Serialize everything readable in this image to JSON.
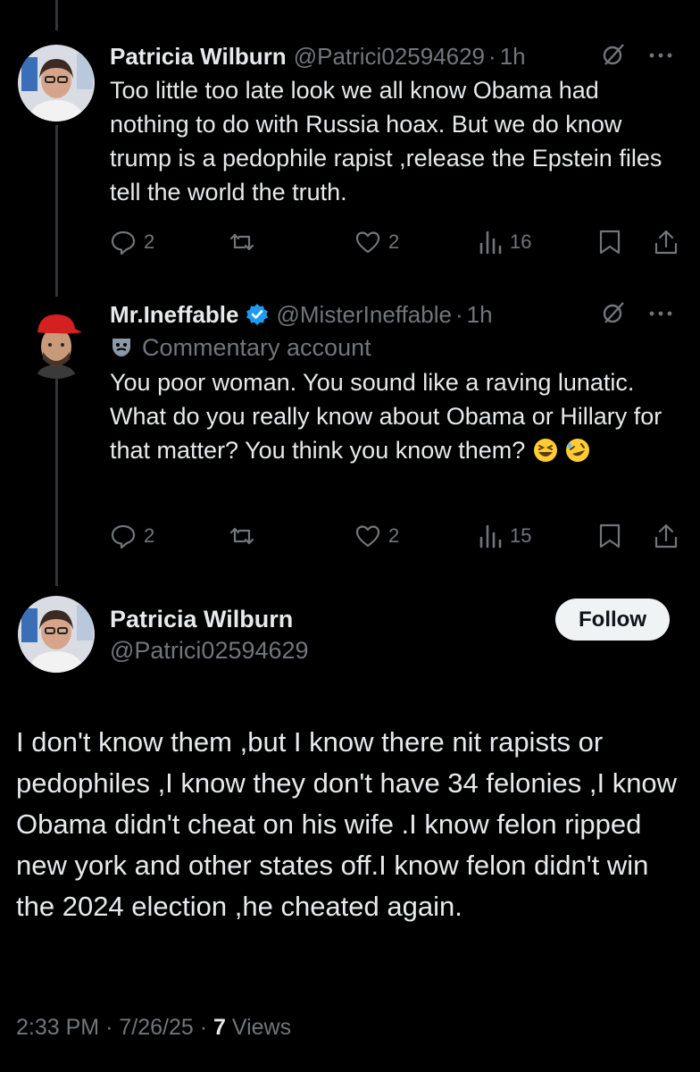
{
  "reply1": {
    "name": "Patricia Wilburn",
    "handle": "@Patrici02594629",
    "time": "1h",
    "text": "Too little too late look we all know Obama had nothing to do with Russia hoax. But we do know trump is a pedophile rapist ,release the Epstein files tell the world the truth.",
    "replies": "2",
    "likes": "2",
    "views": "16"
  },
  "reply2": {
    "name": "Mr.Ineffable",
    "handle": "@MisterIneffable",
    "time": "1h",
    "label": "Commentary account",
    "text": "You poor woman. You sound like a raving lunatic. What do you really know about Obama or Hillary for that matter? You think you know them?",
    "replies": "2",
    "likes": "2",
    "views": "15"
  },
  "main": {
    "name": "Patricia Wilburn",
    "handle": "@Patrici02594629",
    "follow_label": "Follow",
    "text": "I don't know them ,but I know there nit rapists or pedophiles ,I know they don't have 34 felonies ,I know Obama didn't cheat on his wife .I know felon ripped new york and other states off.I know felon didn't win the 2024 election ,he cheated again.",
    "time": "2:33 PM",
    "date": "7/26/25",
    "views_count": "7",
    "views_label": "Views"
  },
  "colors": {
    "background": "#000000",
    "text": "#e7e9ea",
    "muted": "#71767b",
    "verified": "#1d9bf0",
    "follow_bg": "#eff3f4"
  }
}
